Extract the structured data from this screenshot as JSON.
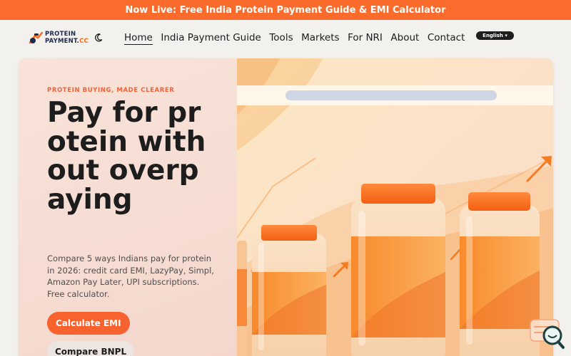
{
  "announcement": "Now Live: Free India Protein Payment Guide & EMI Calculator",
  "brand": {
    "line1": "PROTEIN",
    "line2a": "PAYMENT.",
    "line2b": "CC"
  },
  "nav": [
    "Home",
    "India Payment Guide",
    "Tools",
    "Markets",
    "For NRI",
    "About",
    "Contact"
  ],
  "nav_active": "Home",
  "language": "English ▾",
  "hero": {
    "eyebrow": "PROTEIN BUYING, MADE CLEARER",
    "headline": "Pay for protein without overpaying",
    "subtitle": "Compare 5 ways Indians pay for protein in 2026: credit card EMI, LazyPay, Simpl, Amazon Pay Later, UPI subscriptions. Free calculator.",
    "primary_cta": "Calculate EMI",
    "secondary_cta": "Compare BNPL"
  },
  "icons": [
    "logo-icon",
    "moon-icon",
    "chat-icon"
  ],
  "colors": {
    "accent": "#fa6b2c",
    "text": "#1d1d1d",
    "hero_bg": "#f6dcd0"
  }
}
